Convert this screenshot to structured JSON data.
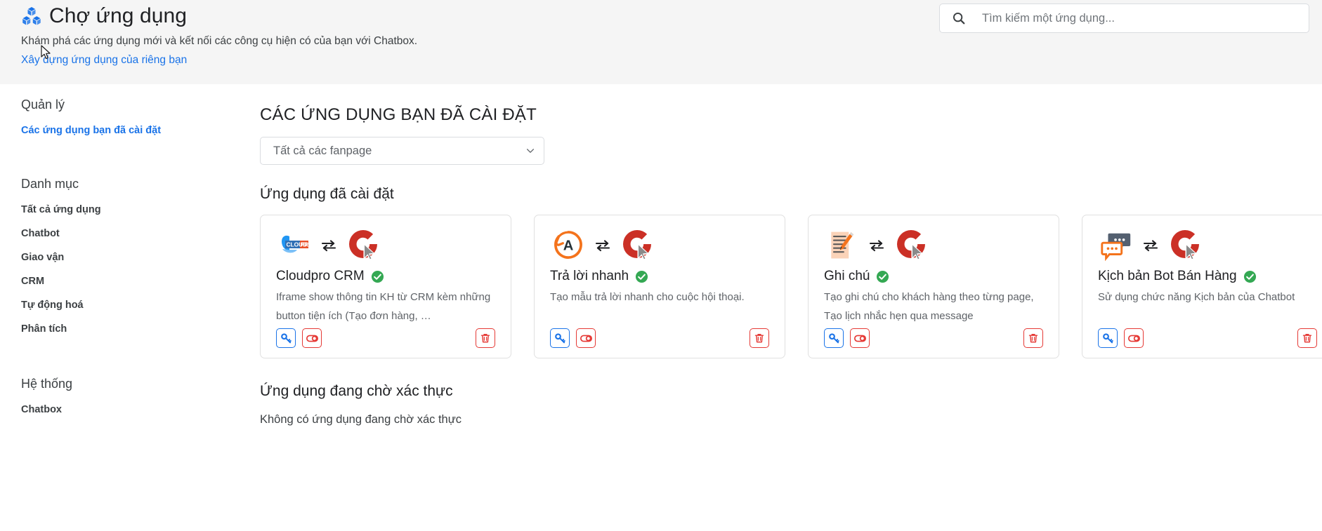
{
  "header": {
    "icon": "cubes-icon",
    "title": "Chợ ứng dụng",
    "subtitle": "Khám phá các ứng dụng mới và kết nối các công cụ hiện có của bạn với Chatbox.",
    "build_link": "Xây dựng ứng dụng của riêng bạn"
  },
  "search": {
    "icon": "search-icon",
    "placeholder": "Tìm kiếm một ứng dụng...",
    "value": ""
  },
  "sidebar": {
    "groups": [
      {
        "title": "Quản lý",
        "items": [
          {
            "label": "Các ứng dụng bạn đã cài đặt",
            "active": true
          }
        ]
      },
      {
        "title": "Danh mục",
        "items": [
          {
            "label": "Tất cả ứng dụng",
            "active": false
          },
          {
            "label": "Chatbot",
            "active": false
          },
          {
            "label": "Giao vận",
            "active": false
          },
          {
            "label": "CRM",
            "active": false
          },
          {
            "label": "Tự động hoá",
            "active": false
          },
          {
            "label": "Phân tích",
            "active": false
          }
        ]
      },
      {
        "title": "Hệ thống",
        "items": [
          {
            "label": "Chatbox",
            "active": false
          }
        ]
      }
    ]
  },
  "main": {
    "heading": "CÁC ỨNG DỤNG BẠN ĐÃ CÀI ĐẶT",
    "fanpage_filter": {
      "selected": "Tất cả các fanpage",
      "options": [
        "Tất cả các fanpage"
      ]
    },
    "installed_section_title": "Ứng dụng đã cài đặt",
    "pending_section_title": "Ứng dụng đang chờ xác thực",
    "pending_empty_text": "Không có ứng dụng đang chờ xác thực",
    "apps": [
      {
        "name": "Cloudpro CRM",
        "description": "Iframe show thông tin KH từ CRM kèm những button tiện ích (Tạo đơn hàng, …",
        "verified": true,
        "logo": "cloudpro-logo-icon",
        "actions": {
          "key_label": "key-icon",
          "toggle_label": "toggle-icon",
          "delete_label": "trash-icon"
        }
      },
      {
        "name": "Trả lời nhanh",
        "description": "Tạo mẫu trả lời nhanh cho cuộc hội thoại.",
        "verified": true,
        "logo": "quick-reply-logo-icon",
        "actions": {
          "key_label": "key-icon",
          "toggle_label": "toggle-icon",
          "delete_label": "trash-icon"
        }
      },
      {
        "name": "Ghi chú",
        "description": "Tạo ghi chú cho khách hàng theo từng page, Tạo lịch nhắc hẹn qua message",
        "verified": true,
        "logo": "note-logo-icon",
        "actions": {
          "key_label": "key-icon",
          "toggle_label": "toggle-icon",
          "delete_label": "trash-icon"
        }
      },
      {
        "name": "Kịch bản Bot Bán Hàng",
        "description": "Sử dụng chức năng Kịch bản của Chatbot",
        "verified": true,
        "logo": "bot-script-logo-icon",
        "actions": {
          "key_label": "key-icon",
          "toggle_label": "toggle-icon",
          "delete_label": "trash-icon"
        }
      }
    ]
  },
  "colors": {
    "accent_blue": "#1a73e8",
    "danger_red": "#e53935",
    "verified_green": "#34a853",
    "chatbox_red": "#cb3026",
    "header_bg": "#f5f5f5"
  }
}
